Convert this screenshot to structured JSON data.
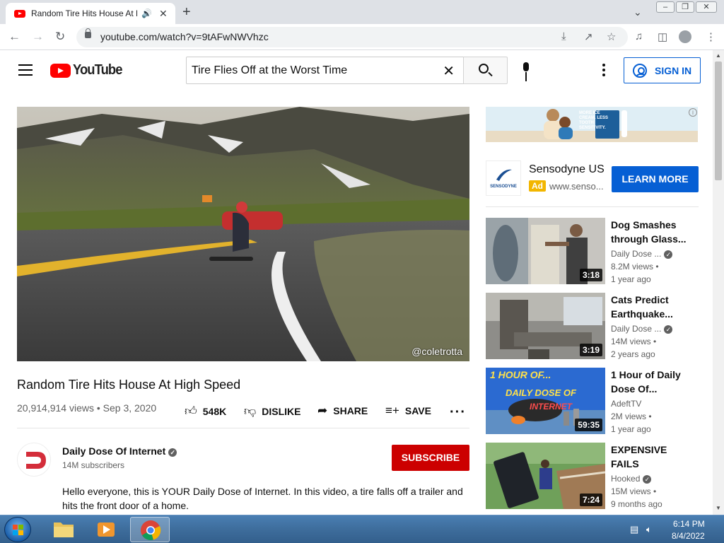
{
  "browser": {
    "tab_title": "Random Tire Hits House At High Speed - YouTube",
    "url": "youtube.com/watch?v=9tAFwNWVhzc"
  },
  "header": {
    "logo_text": "YouTube",
    "search_value": "Tire Flies Off at the Worst Time",
    "signin_label": "SIGN IN"
  },
  "video": {
    "title": "Random Tire Hits House At High Speed",
    "meta": "20,914,914 views • Sep 3, 2020",
    "watermark": "@coletrotta",
    "likes": "548K",
    "dislike_label": "DISLIKE",
    "share_label": "SHARE",
    "save_label": "SAVE"
  },
  "channel": {
    "name": "Daily Dose Of Internet",
    "subscribers": "14M subscribers",
    "subscribe_label": "SUBSCRIBE",
    "description": "Hello everyone, this is YOUR Daily Dose of Internet. In this video, a tire falls off a trailer and hits the front door of a home."
  },
  "ad": {
    "banner_text": "MORE ICE CREAM. LESS TOOTH SENSITIVITY.",
    "advertiser": "Sensodyne US",
    "badge": "Ad",
    "url": "www.senso...",
    "logo_text": "SENSODYNE",
    "cta": "LEARN MORE"
  },
  "recommendations": [
    {
      "title": "Dog Smashes through Glass...",
      "channel": "Daily Dose ...",
      "views": "8.2M views •",
      "age": "1 year ago",
      "duration": "3:18",
      "verified": true
    },
    {
      "title": "Cats Predict Earthquake...",
      "channel": "Daily Dose ...",
      "views": "14M views •",
      "age": "2 years ago",
      "duration": "3:19",
      "verified": true
    },
    {
      "title": "1 Hour of Daily Dose Of...",
      "channel": "AdeftTV",
      "views": "2M views •",
      "age": "1 year ago",
      "duration": "59:35",
      "verified": false,
      "thumb_text_1": "1 HOUR OF...",
      "thumb_text_2": "DAILY DOSE OF",
      "thumb_text_3": "INTERNET"
    },
    {
      "title": "EXPENSIVE FAILS",
      "channel": "Hooked",
      "views": "15M views •",
      "age": "9 months ago",
      "duration": "7:24",
      "verified": true
    }
  ],
  "taskbar": {
    "time": "6:14 PM",
    "date": "8/4/2022"
  },
  "colors": {
    "youtube_red": "#ff0000",
    "subscribe_red": "#cc0000",
    "link_blue": "#065fd4",
    "ad_yellow": "#f2b600"
  }
}
